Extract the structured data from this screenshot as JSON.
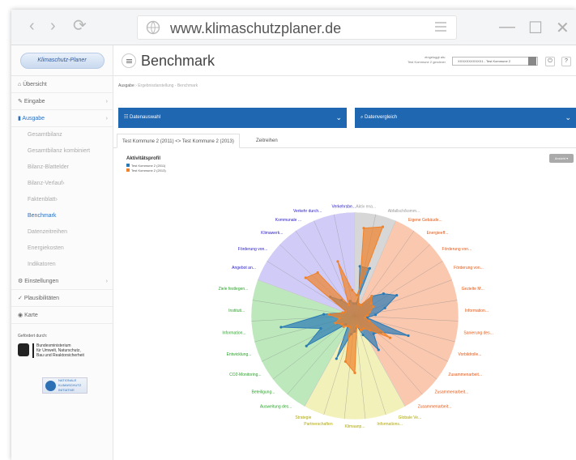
{
  "browser": {
    "url": "www.klimaschutzplaner.de",
    "nav_back": "‹",
    "nav_forward": "›",
    "nav_reload": "⟳",
    "win_min": "—",
    "win_max": "☐",
    "win_close": "✕"
  },
  "sidebar": {
    "logo": "Klimaschutz-Planer",
    "items": [
      {
        "label": "Übersicht",
        "icon": "home-icon",
        "chevron": false
      },
      {
        "label": "Eingabe",
        "icon": "edit-icon",
        "chevron": true
      },
      {
        "label": "Ausgabe",
        "icon": "chart-icon",
        "chevron": true,
        "active": true
      }
    ],
    "subitems": [
      {
        "label": "Gesamtbilanz"
      },
      {
        "label": "Gesamtbilanz kombiniert"
      },
      {
        "label": "Bilanz-Blattelder"
      },
      {
        "label": "Bilanz-Verlauf",
        "chevron": true
      },
      {
        "label": "Faktenblatt",
        "chevron": true
      },
      {
        "label": "Benchmark",
        "active": true
      },
      {
        "label": "Datenzeitreihen"
      },
      {
        "label": "Energiekosten"
      },
      {
        "label": "Indikatoren"
      }
    ],
    "items2": [
      {
        "label": "Einstellungen",
        "icon": "gear-icon",
        "chevron": true
      },
      {
        "label": "Plausibilitäten",
        "icon": "check-icon",
        "chevron": false
      },
      {
        "label": "Karte",
        "icon": "map-icon",
        "chevron": false
      }
    ],
    "funded_label": "Gefördert durch:",
    "bmub_text": [
      "Bundesministerium",
      "für Umwelt, Naturschutz,",
      "Bau und Reaktorsicherheit"
    ],
    "nki_text": [
      "NATIONALE",
      "KLIMASCHUTZ",
      "INITIATIVE"
    ]
  },
  "header": {
    "title": "Benchmark",
    "login_line1": "eingeloggt als:",
    "login_line2": "Test Kommune 2 gerchner",
    "commune_select": "XXXXXXXXXXX1 - Test Kommune 2",
    "btn_power": "⏻",
    "btn_help": "?"
  },
  "breadcrumb": {
    "root": "Ausgabe",
    "sep": "›",
    "path": "Ergebnisdarstellung - Benchmark"
  },
  "panels": {
    "left": {
      "label": "Datenauswahl",
      "icon": "grid-icon"
    },
    "right": {
      "label": "Datenvergleich",
      "icon": "search-icon"
    },
    "caret": "⌄"
  },
  "tabs": [
    {
      "label": "Test Kommune 2 (2011) <> Test Kommune 2 (2013)",
      "active": true
    },
    {
      "label": "Zeitreihen",
      "active": false
    }
  ],
  "ansicht_button": "Ansicht ▾",
  "chart_data": {
    "type": "radar",
    "title": "Aktivitätsprofil",
    "series": [
      {
        "name": "Test Kommune 2 (2011)",
        "color": "#2a7ab5",
        "values": [
          0.48,
          0.12,
          0.12,
          0.25,
          0.35,
          0.45,
          0.3,
          0.2,
          0.12,
          0.55,
          0.3,
          0.25,
          0.4,
          0.2,
          0.1,
          0.15,
          0.18,
          0.45,
          0.12,
          0.12,
          0.55,
          0.35,
          0.72,
          0.3,
          0.12,
          0.1,
          0.3,
          0.2,
          0.12,
          0.15,
          0.12,
          0.12,
          0.48
        ]
      },
      {
        "name": "Test Kommune 2 (2013)",
        "color": "#f0822a",
        "values": [
          0.85,
          0.12,
          0.12,
          0.25,
          0.2,
          0.2,
          0.15,
          0.12,
          0.1,
          0.15,
          0.4,
          0.2,
          0.15,
          0.15,
          0.1,
          0.55,
          0.45,
          0.12,
          0.12,
          0.15,
          0.15,
          0.2,
          0.15,
          0.25,
          0.12,
          0.1,
          0.6,
          0.55,
          0.12,
          0.55,
          0.25,
          0.2,
          0.9
        ]
      }
    ],
    "max": 1,
    "sectors": [
      {
        "color": "#bdbdbd",
        "label_color": "#999999",
        "labels": [
          "Aktiv ena...",
          "Abfallsch/komm..."
        ]
      },
      {
        "color": "#f7a17a",
        "label_color": "#e8550f",
        "labels": [
          "Eigene Gebäude...",
          "Energieeff...",
          "Förderung von...",
          "Förderung von...",
          "Gezielte M...",
          "Information...",
          "Sanierung des...",
          "Vorbildrolle...",
          "Zusammenarbeit...",
          "Zusammenarbeit...",
          "Zusammenarbeit..."
        ]
      },
      {
        "color": "#e9e88a",
        "label_color": "#b0a800",
        "labels": [
          "Globale Ve...",
          "Informations...",
          "Klimaanp...",
          "Partnerschaften",
          "Strategie"
        ]
      },
      {
        "color": "#8fd98f",
        "label_color": "#28a428",
        "labels": [
          "Ausweitung des...",
          "Beteiligung...",
          "CO2-Monitoring...",
          "Entwicklung...",
          "Information...",
          "Instituti...",
          "Ziele festlegen..."
        ]
      },
      {
        "color": "#b3aaf2",
        "label_color": "#2b20c9",
        "labels": [
          "Angebot an...",
          "Förderung von...",
          "Klimawerk...",
          "Kommunale ...",
          "Verkehr durch...",
          "Verkehrsbe..."
        ]
      }
    ]
  }
}
